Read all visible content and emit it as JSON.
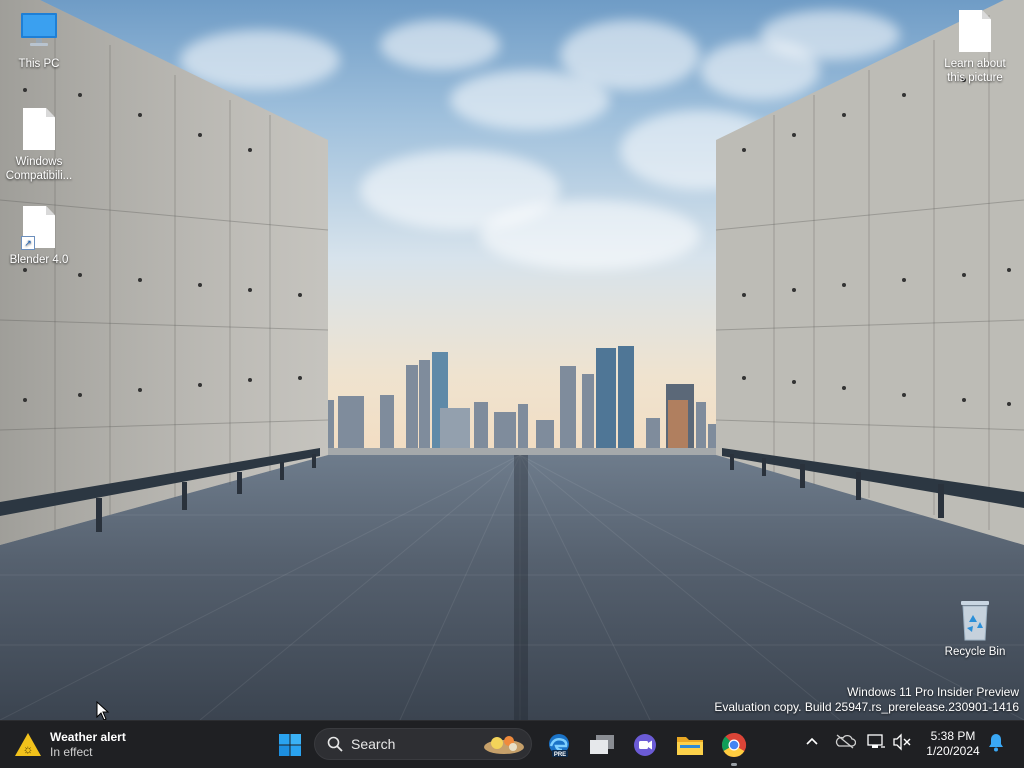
{
  "desktop": {
    "icons": [
      {
        "label": "This PC",
        "icon": "monitor-icon"
      },
      {
        "label": "Windows Compatibili...",
        "icon": "document-icon"
      },
      {
        "label": "Blender 4.0",
        "icon": "shortcut-document-icon"
      },
      {
        "label": "Learn about this picture",
        "icon": "document-icon"
      },
      {
        "label": "Recycle Bin",
        "icon": "recycle-bin-icon"
      }
    ],
    "watermark": {
      "line1": "Windows 11 Pro Insider Preview",
      "line2": "Evaluation copy. Build 25947.rs_prerelease.230901-1416"
    }
  },
  "taskbar": {
    "weather": {
      "title": "Weather alert",
      "subtitle": "In effect",
      "icon": "weather-warning-icon"
    },
    "start": {
      "icon": "windows-start-icon"
    },
    "search": {
      "placeholder": "Search",
      "icon": "search-icon"
    },
    "apps": [
      {
        "name": "Microsoft Edge Dev",
        "icon": "edge-pre-icon",
        "badge": "PRE"
      },
      {
        "name": "Task View",
        "icon": "task-view-icon"
      },
      {
        "name": "Teams Meet",
        "icon": "teams-icon"
      },
      {
        "name": "File Explorer",
        "icon": "folder-icon"
      },
      {
        "name": "Google Chrome",
        "icon": "chrome-icon",
        "running": true
      }
    ],
    "tray": {
      "icons": [
        "chevron-up-icon",
        "onedrive-icon",
        "network-icon",
        "volume-mute-icon"
      ]
    },
    "clock": {
      "time": "5:38 PM",
      "date": "1/20/2024"
    },
    "notifications": {
      "icon": "bell-icon"
    }
  },
  "colors": {
    "taskbar_bg": "#1f2023",
    "accent_blue": "#0078d4",
    "text": "#ffffff"
  }
}
